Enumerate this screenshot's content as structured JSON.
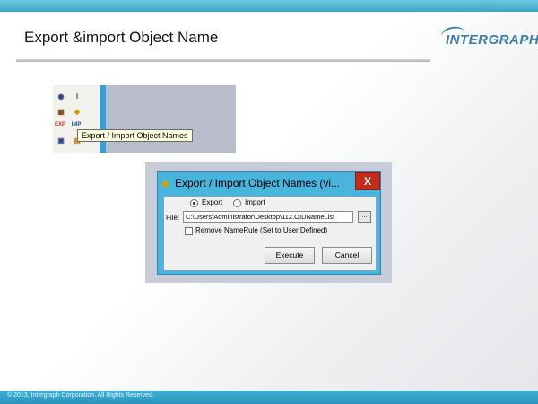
{
  "slide": {
    "title": "Export &import Object Name",
    "brand": "INTERGRAPH",
    "footer": "© 2013, Intergraph Corporation. All Rights Reserved."
  },
  "toolbar": {
    "icons": [
      "eye-icon",
      "text-i-icon",
      "fill-icon",
      "tag-icon",
      "exp-icon",
      "imp-icon",
      "view-icon",
      "rename-icon"
    ],
    "icon_labels": {
      "exp": "EXP",
      "imp": "IMP"
    },
    "tooltip": "Export / Import Object Names",
    "colors": {
      "accent": "#2ea3d6",
      "background": "#b8bccb"
    }
  },
  "dialog": {
    "title": "Export / Import Object Names (vi...",
    "close_label": "X",
    "mode_options": [
      {
        "label": "Export",
        "selected": true
      },
      {
        "label": "Import",
        "selected": false
      }
    ],
    "file_label": "File:",
    "file_value": "C:\\Users\\Administrator\\Desktop\\112.OIDNameList",
    "browse_label": "...",
    "remove_namerule_label": "Remove NameRule (Set to User Defined)",
    "remove_namerule_checked": false,
    "execute_label": "Execute",
    "cancel_label": "Cancel",
    "colors": {
      "frame": "#49b4dc",
      "close": "#c42b1c"
    }
  }
}
